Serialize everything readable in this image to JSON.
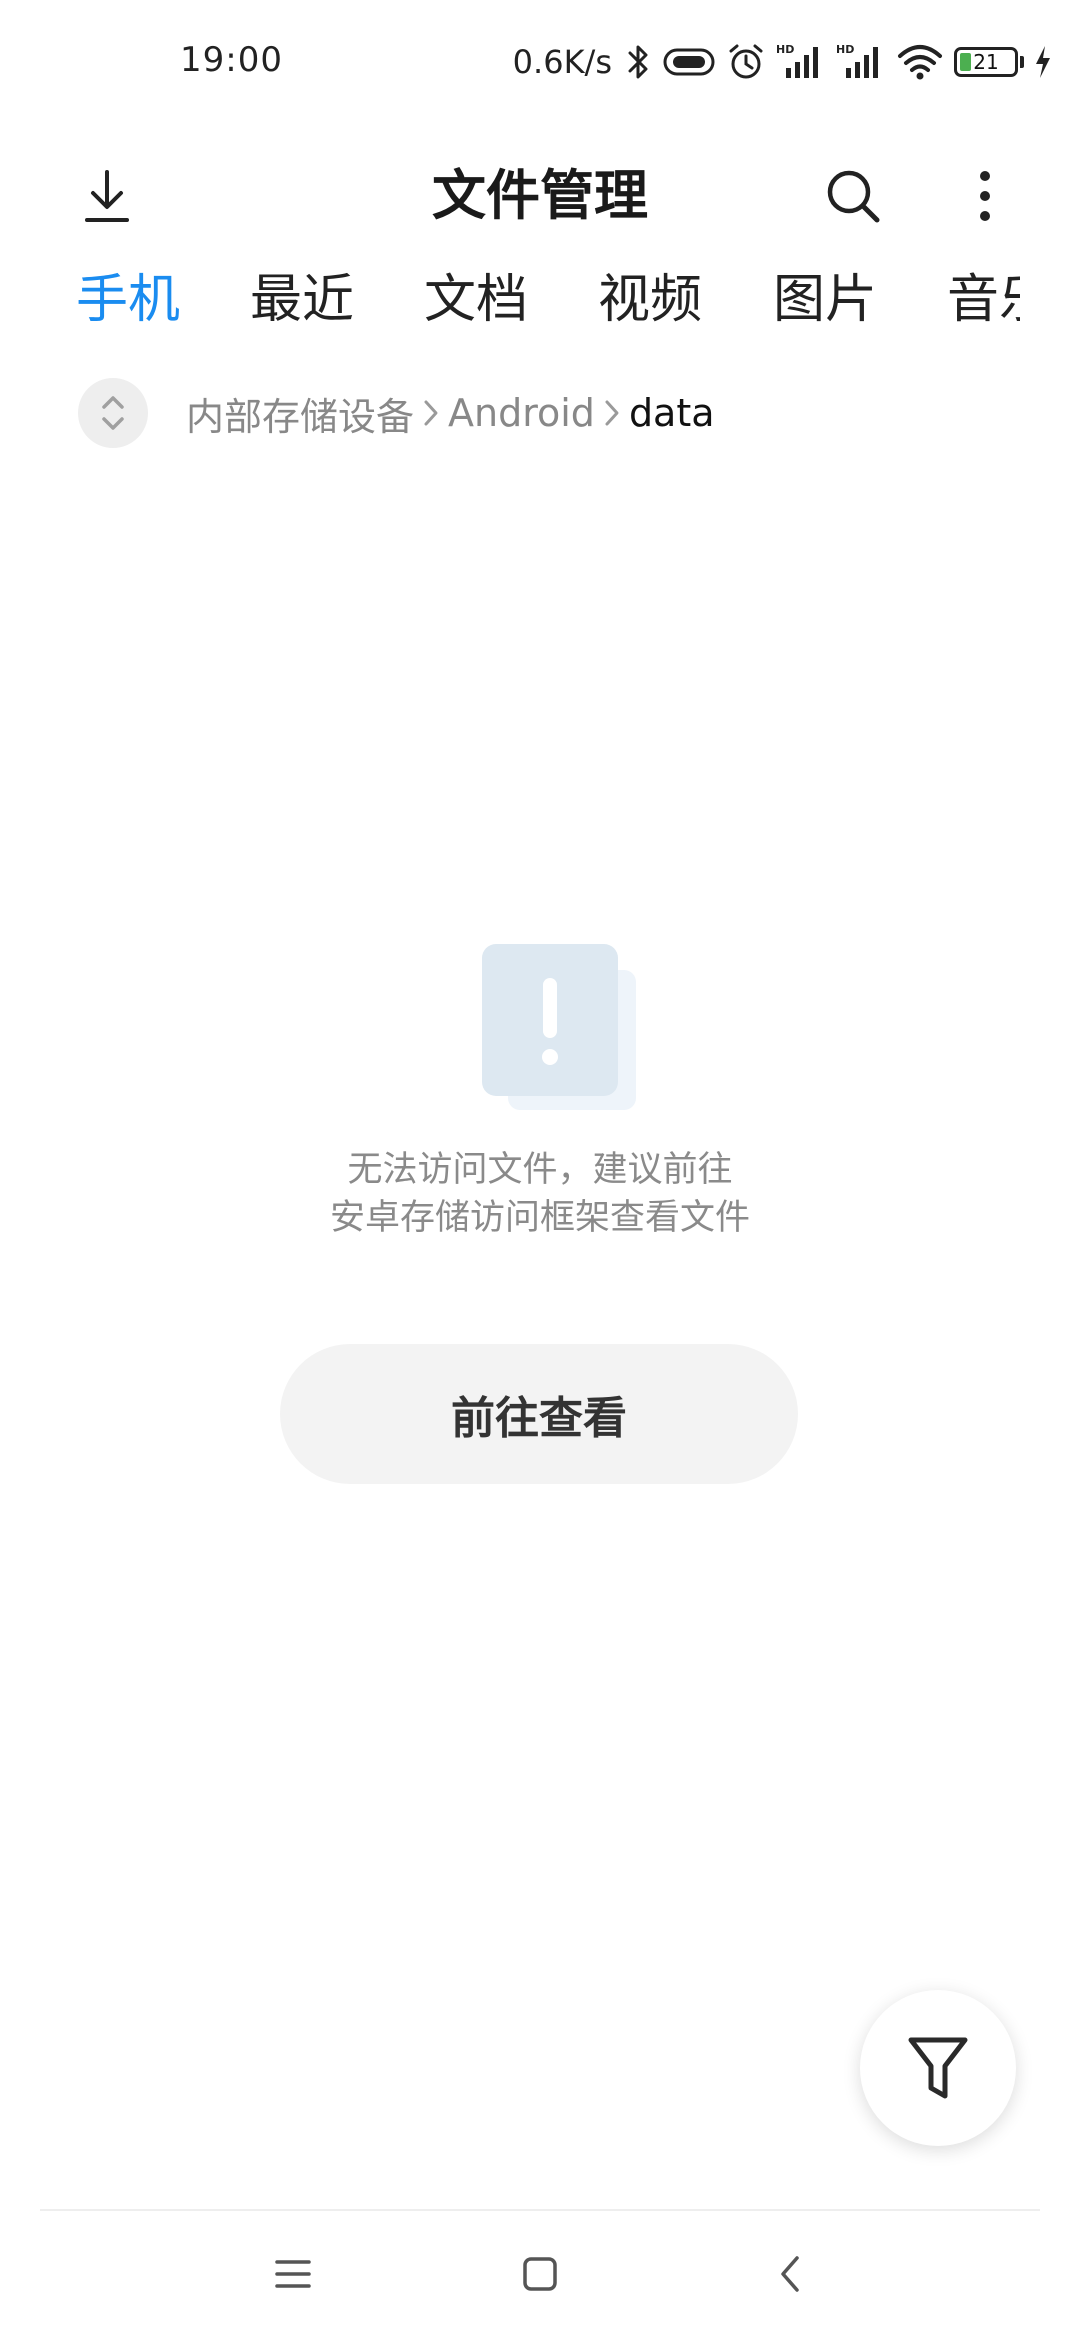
{
  "status_bar": {
    "time": "19:00",
    "network_speed": "0.6K/s",
    "battery_level": "21",
    "battery_fraction": 0.21,
    "icons": [
      "bluetooth-icon",
      "vibrate-icon",
      "alarm-icon",
      "signal-hd-icon",
      "signal-hd-icon",
      "wifi-icon",
      "battery-icon",
      "charging-icon"
    ]
  },
  "app_bar": {
    "title": "文件管理",
    "icons": [
      "download-icon",
      "search-icon",
      "more-vertical-icon"
    ]
  },
  "tabs": [
    {
      "label": "手机",
      "active": true
    },
    {
      "label": "最近",
      "active": false
    },
    {
      "label": "文档",
      "active": false
    },
    {
      "label": "视频",
      "active": false
    },
    {
      "label": "图片",
      "active": false
    },
    {
      "label": "音乐",
      "active": false
    }
  ],
  "breadcrumb": {
    "items": [
      "内部存储设备",
      "Android",
      "data"
    ]
  },
  "empty_state": {
    "line1": "无法访问文件，建议前往",
    "line2": "安卓存储访问框架查看文件",
    "button_label": "前往查看"
  },
  "colors": {
    "accent": "#1a8cf0",
    "battery": "#4caf50",
    "button_bg": "#f3f3f3"
  }
}
